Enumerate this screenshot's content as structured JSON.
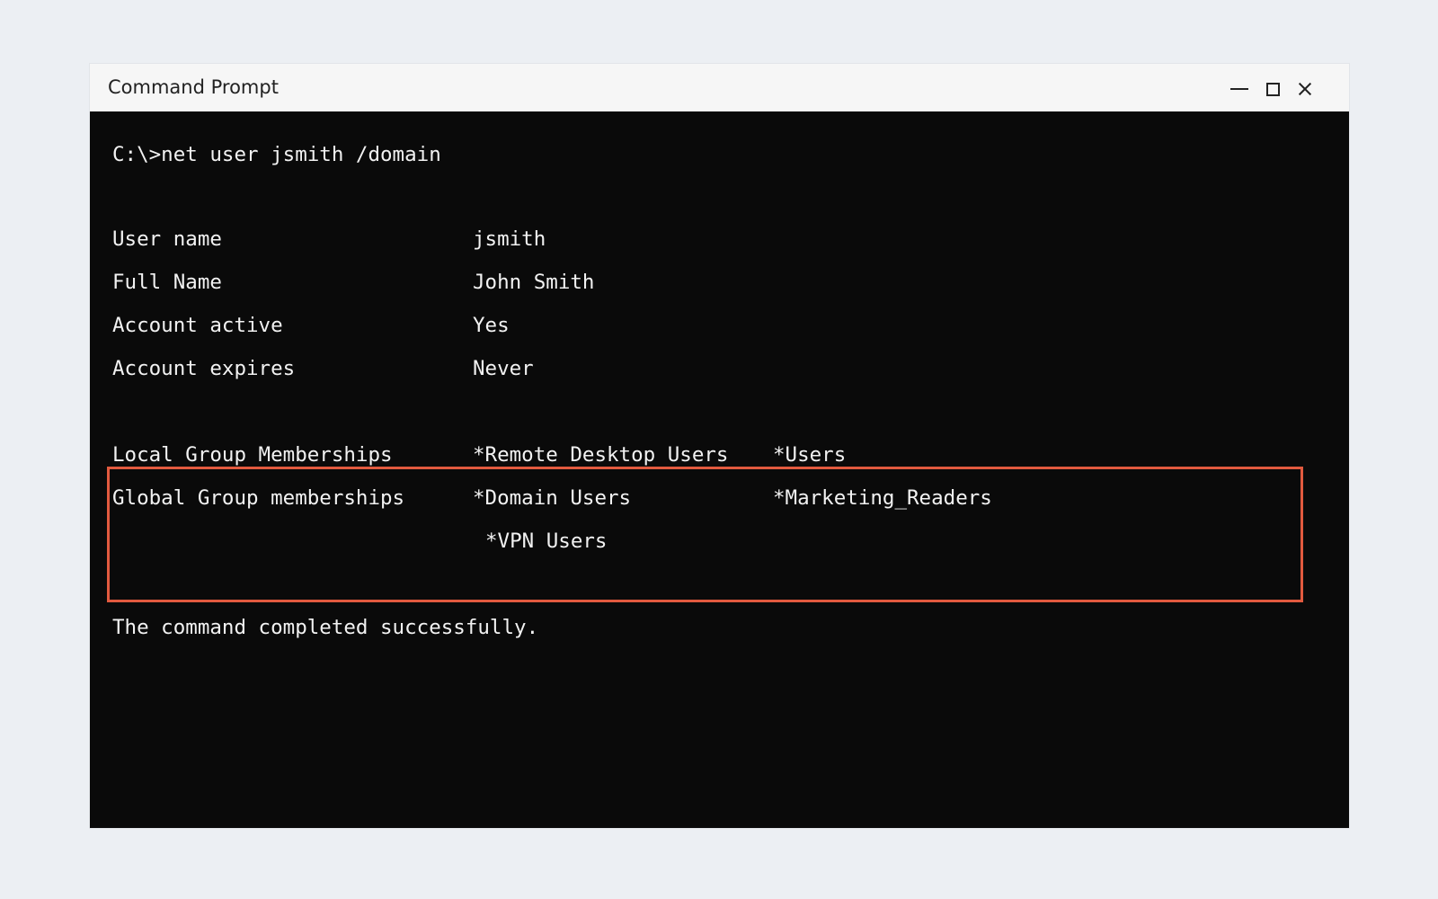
{
  "window": {
    "title": "Command Prompt",
    "controls": {
      "minimize_icon": "minimize-icon",
      "maximize_icon": "maximize-icon",
      "close_icon": "close-icon"
    }
  },
  "terminal": {
    "command_line": "C:\\>net user jsmith /domain",
    "fields": [
      {
        "label": "User name",
        "value": "jsmith"
      },
      {
        "label": "Full Name",
        "value": "John Smith"
      },
      {
        "label": "Account active",
        "value": "Yes"
      },
      {
        "label": "Account expires",
        "value": "Never"
      }
    ],
    "group_memberships": {
      "local_label": "Local Group Memberships",
      "local_groups": [
        "*Remote Desktop Users",
        "*Users"
      ],
      "global_label": "Global Group memberships",
      "global_groups": [
        "*Domain Users",
        "*Marketing_Readers",
        "*VPN Users"
      ]
    },
    "completion_message": "The command completed successfully."
  },
  "colors": {
    "desktop_background": "#eceff3",
    "titlebar_background": "#f6f6f6",
    "console_background": "#0a0a0a",
    "console_text": "#f2f2f2",
    "highlight_border": "#e25a3f"
  }
}
